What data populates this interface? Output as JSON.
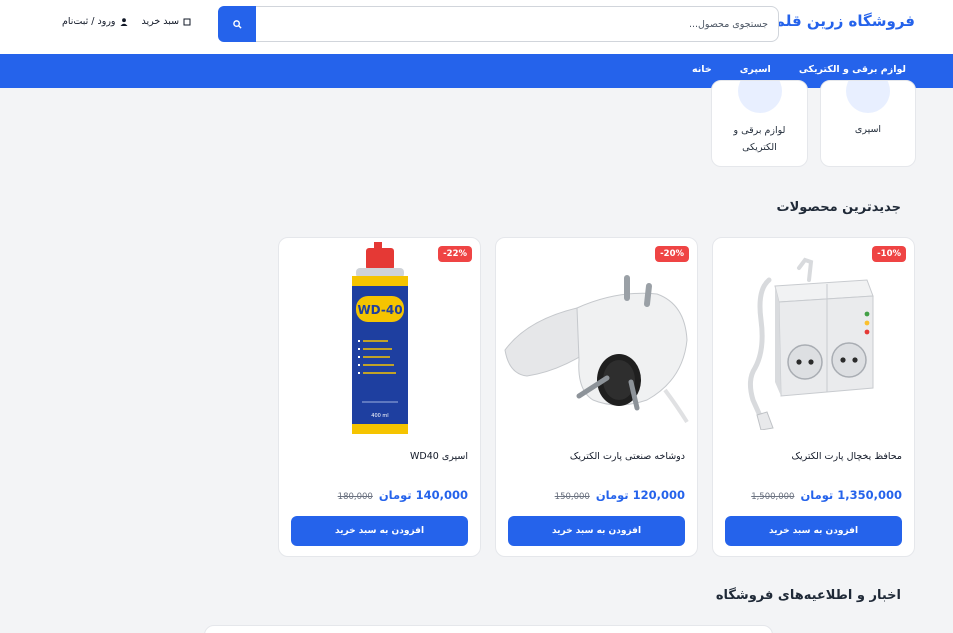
{
  "header": {
    "brand": "فروشگاه زرین قلم",
    "search_placeholder": "جستجوی محصول...",
    "login_label": "ورود / ثبت‌نام",
    "cart_label": "سبد خرید"
  },
  "nav": {
    "items": [
      {
        "label": "خانه"
      },
      {
        "label": "اسپری"
      },
      {
        "label": "لوازم برقی و الکتریکی"
      }
    ]
  },
  "categories": [
    {
      "label": "اسپری"
    },
    {
      "label_line1": "لوازم برقی و",
      "label_line2": "الکتریکی"
    }
  ],
  "sections": {
    "newest_title": "جدیدترین محصولات",
    "news_title": "اخبار و اطلاعیه‌های فروشگاه"
  },
  "products": [
    {
      "name": "محافظ یخچال پارت الکتریک",
      "discount": "-10%",
      "old_price": "1,500,000",
      "new_price": "1,350,000 تومان",
      "button": "افزودن به سبد خرید",
      "image_icon": "power-strip-image"
    },
    {
      "name": "دوشاخه صنعتی پارت الکتریک",
      "discount": "-20%",
      "old_price": "150,000",
      "new_price": "120,000 تومان",
      "button": "افزودن به سبد خرید",
      "image_icon": "plug-image"
    },
    {
      "name": "اسپری WD40",
      "discount": "-22%",
      "old_price": "180,000",
      "new_price": "140,000 تومان",
      "button": "افزودن به سبد خرید",
      "image_icon": "spray-can-image"
    }
  ],
  "product_image_texts": {
    "wd40_logo": "WD-40",
    "wd40_size": "400 ml"
  },
  "colors": {
    "primary": "#2563eb",
    "discount": "#ef4444",
    "background": "#f3f4f6"
  }
}
